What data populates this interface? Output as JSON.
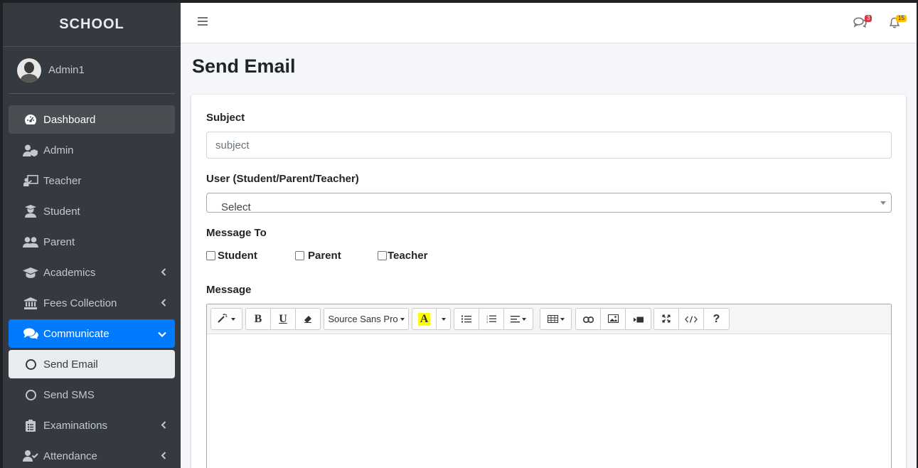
{
  "sidebar": {
    "brand": "SCHOOL",
    "user_name": "Admin1",
    "items": [
      {
        "label": "Dashboard",
        "icon": "tachometer-icon",
        "state": "active"
      },
      {
        "label": "Admin",
        "icon": "user-shield-icon"
      },
      {
        "label": "Teacher",
        "icon": "chalkboard-teacher-icon"
      },
      {
        "label": "Student",
        "icon": "user-graduate-icon"
      },
      {
        "label": "Parent",
        "icon": "users-icon"
      },
      {
        "label": "Academics",
        "icon": "graduation-cap-icon",
        "chevron": "left"
      },
      {
        "label": "Fees Collection",
        "icon": "university-icon",
        "chevron": "left"
      },
      {
        "label": "Communicate",
        "icon": "comments-icon",
        "chevron": "down",
        "state": "open"
      },
      {
        "label": "Send Email",
        "icon": "circle-icon",
        "state": "selected"
      },
      {
        "label": "Send SMS",
        "icon": "circle-icon"
      },
      {
        "label": "Examinations",
        "icon": "clipboard-list-icon",
        "chevron": "left"
      },
      {
        "label": "Attendance",
        "icon": "user-check-icon",
        "chevron": "left"
      }
    ]
  },
  "topbar": {
    "messages_badge": "3",
    "notifications_badge": "15"
  },
  "page": {
    "title": "Send Email"
  },
  "form": {
    "subject_label": "Subject",
    "subject_placeholder": "subject",
    "user_label": "User (Student/Parent/Teacher)",
    "user_selected": "Select",
    "message_to_label": "Message To",
    "recipients": [
      "Student",
      "Parent",
      "Teacher"
    ],
    "message_label": "Message"
  },
  "editor": {
    "font_name": "Source Sans Pro",
    "highlight_glyph": "A",
    "bold_glyph": "B",
    "underline_glyph": "U",
    "help_glyph": "?"
  },
  "colors": {
    "sidebar_bg": "#343a40",
    "accent": "#007bff",
    "badge_red": "#dc3545",
    "badge_yellow": "#ffc107"
  }
}
